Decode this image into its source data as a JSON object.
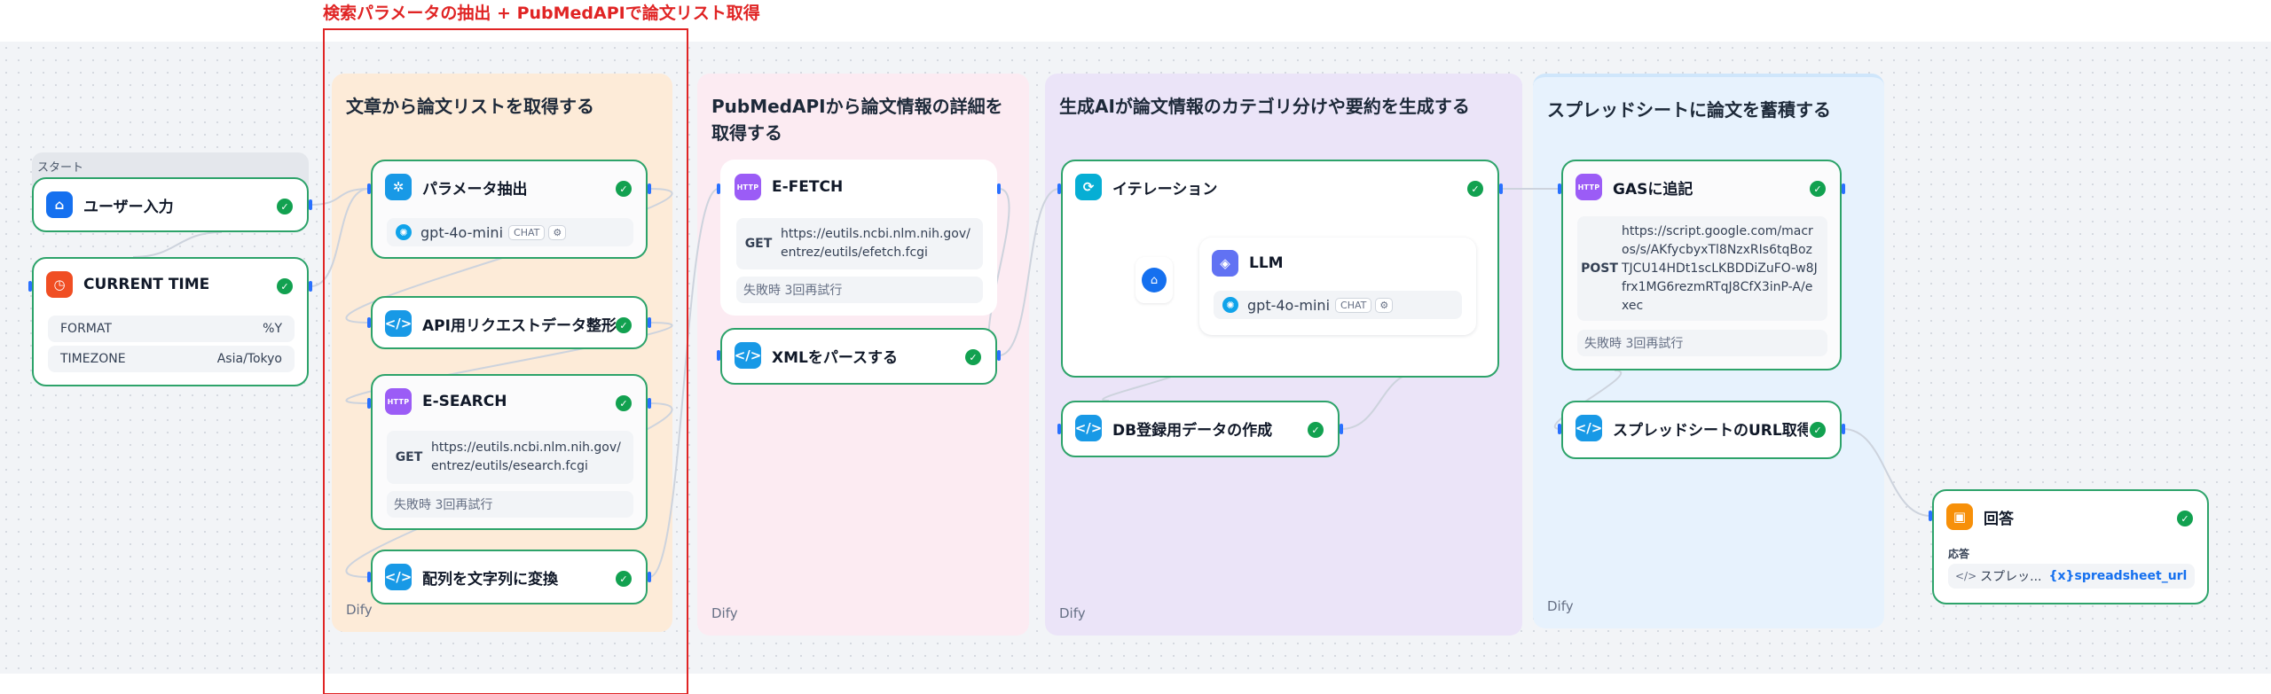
{
  "annotation": {
    "label": "検索パラメータの抽出 + PubMedAPIで論文リスト取得"
  },
  "groups": [
    {
      "title": "文章から論文リストを取得する",
      "footer": "Dify"
    },
    {
      "title": "PubMedAPIから論文情報の詳細を取得する",
      "footer": "Dify"
    },
    {
      "title": "生成AIが論文情報のカテゴリ分けや要約を生成する",
      "footer": "Dify"
    },
    {
      "title": "スプレッドシートに論文を蓄積する",
      "footer": "Dify"
    }
  ],
  "start": {
    "label": "スタート",
    "user_input": {
      "title": "ユーザー入力",
      "icon": "home-icon"
    },
    "current_time": {
      "title": "CURRENT TIME",
      "icon": "clock-icon",
      "fields": [
        {
          "key": "FORMAT",
          "value": "%Y"
        },
        {
          "key": "TIMEZONE",
          "value": "Asia/Tokyo"
        }
      ]
    }
  },
  "nodes": {
    "param_extract": {
      "title": "パラメータ抽出",
      "model": "gpt-4o-mini",
      "chip": "CHAT",
      "icon": "parameter-extractor-icon"
    },
    "api_format": {
      "title": "API用リクエストデータ整形",
      "icon": "code-icon"
    },
    "esearch": {
      "title": "E-SEARCH",
      "icon_text": "HTTP",
      "method": "GET",
      "url": "https://eutils.ncbi.nlm.nih.gov/entrez/eutils/esearch.fcgi",
      "retry": "失敗時 3回再試行"
    },
    "array_to_string": {
      "title": "配列を文字列に変換",
      "icon": "code-icon"
    },
    "efetch": {
      "title": "E-FETCH",
      "icon_text": "HTTP",
      "method": "GET",
      "url": "https://eutils.ncbi.nlm.nih.gov/entrez/eutils/efetch.fcgi",
      "retry": "失敗時 3回再試行"
    },
    "xml_parse": {
      "title": "XMLをパースする",
      "icon": "code-icon"
    },
    "iteration": {
      "title": "イテレーション",
      "icon": "iteration-icon"
    },
    "llm": {
      "title": "LLM",
      "model": "gpt-4o-mini",
      "chip": "CHAT",
      "icon": "llm-icon"
    },
    "db_data": {
      "title": "DB登録用データの作成",
      "icon": "code-icon"
    },
    "gas_append": {
      "title": "GASに追記",
      "icon_text": "HTTP",
      "method": "POST",
      "url": "https://script.google.com/macros/s/AKfycbyxTl8NzxRIs6tqBozTJCU14HDt1scLKBDDiZuFO-w8Jfrx1MG6rezmRTqJ8CfX3inP-A/exec",
      "retry": "失敗時 3回再試行"
    },
    "sheet_url": {
      "title": "スプレッドシートのURL取得",
      "icon": "code-icon"
    },
    "answer": {
      "title": "回答",
      "sub_label": "応答",
      "source_node": "スプレッ...",
      "variable": "spreadsheet_url",
      "icon": "answer-icon"
    }
  },
  "colors": {
    "node_border": "#2da36a",
    "success": "#12a150",
    "highlight": "#e02424",
    "link": "#1570ef"
  }
}
